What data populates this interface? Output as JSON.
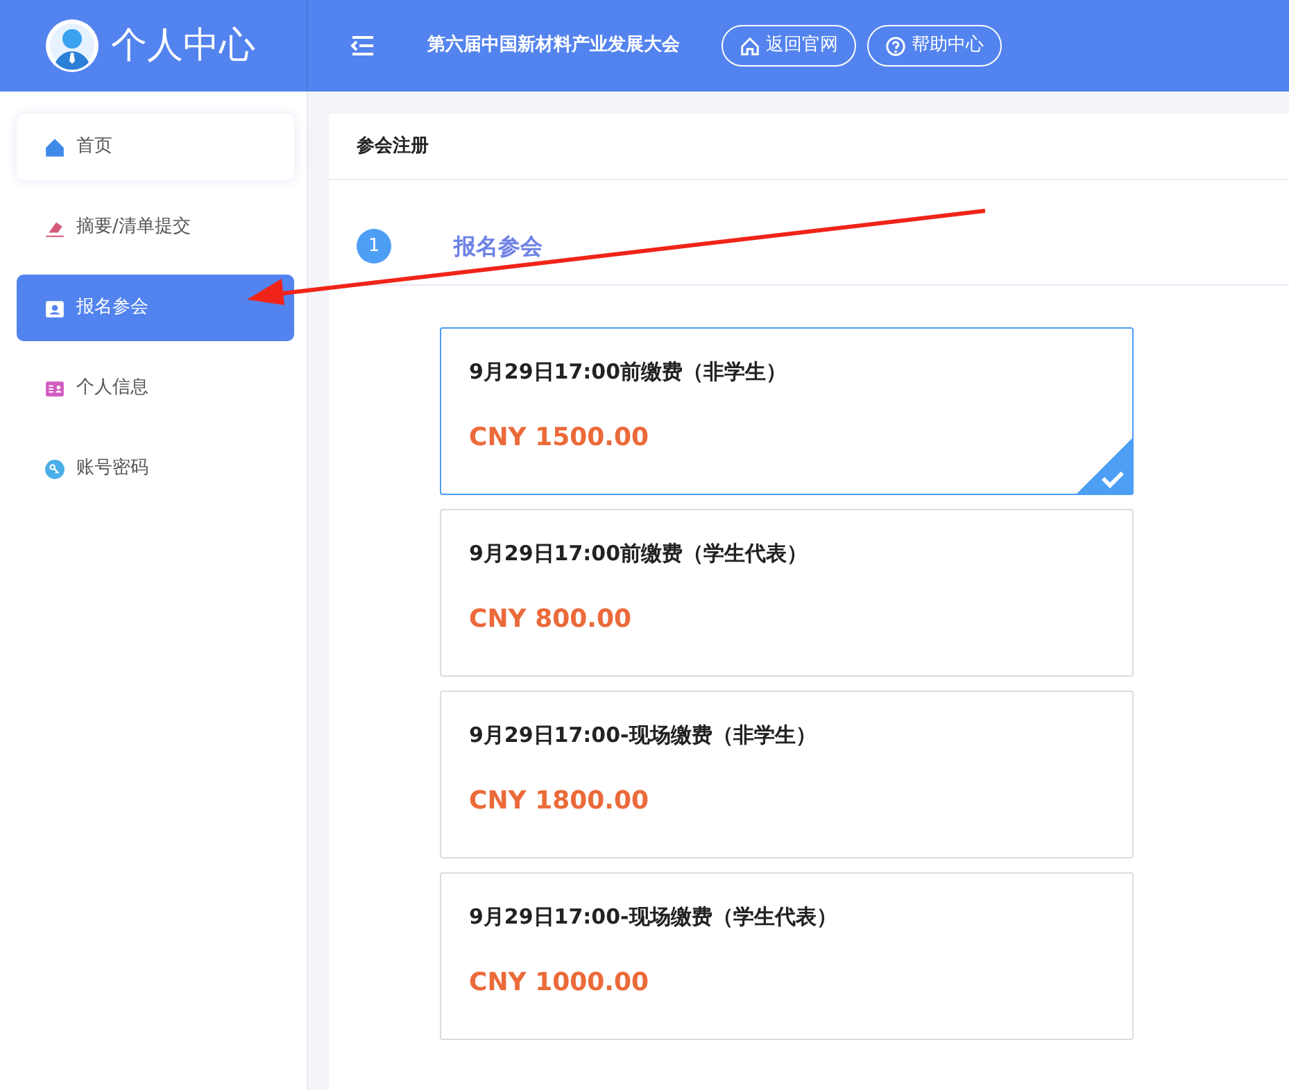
{
  "header": {
    "title": "个人中心",
    "conference": "第六届中国新材料产业发展大会",
    "buttons": [
      {
        "kind": "home",
        "label": "返回官网"
      },
      {
        "kind": "help",
        "label": "帮助中心"
      }
    ]
  },
  "sidebar": {
    "items": [
      {
        "kind": "home",
        "label": "首页",
        "color": "#3f8ae8",
        "selected": false,
        "hovered": true
      },
      {
        "kind": "submit",
        "label": "摘要/清单提交",
        "color": "#d4587a",
        "selected": false,
        "hovered": false
      },
      {
        "kind": "badge",
        "label": "报名参会",
        "color": "#ffffff",
        "selected": true,
        "hovered": false
      },
      {
        "kind": "card",
        "label": "个人信息",
        "color": "#d15cc0",
        "selected": false,
        "hovered": false
      },
      {
        "kind": "key",
        "label": "账号密码",
        "color": "#4aaee8",
        "selected": false,
        "hovered": false
      }
    ]
  },
  "panel": {
    "title": "参会注册",
    "step": {
      "number": "1",
      "label": "报名参会"
    },
    "options": [
      {
        "name": "9月29日17:00前缴费（非学生）",
        "price": "CNY 1500.00",
        "selected": true
      },
      {
        "name": "9月29日17:00前缴费（学生代表）",
        "price": "CNY 800.00",
        "selected": false
      },
      {
        "name": "9月29日17:00-现场缴费（非学生）",
        "price": "CNY 1800.00",
        "selected": false
      },
      {
        "name": "9月29日17:00-现场缴费（学生代表）",
        "price": "CNY 1000.00",
        "selected": false
      }
    ]
  }
}
